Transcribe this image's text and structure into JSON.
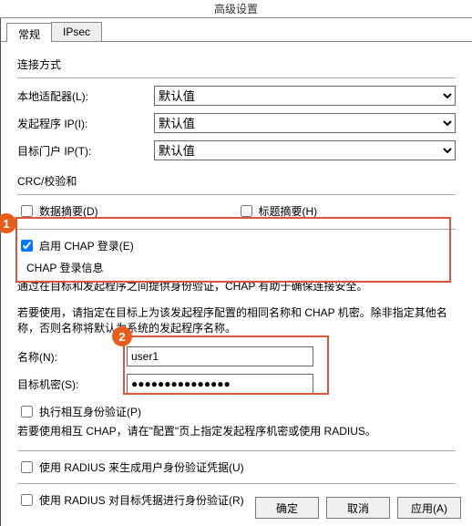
{
  "window": {
    "title": "高级设置"
  },
  "tabs": {
    "general": "常规",
    "ipsec": "IPsec"
  },
  "connection": {
    "group_label": "连接方式",
    "local_adapter_label": "本地适配器(L):",
    "local_adapter_value": "默认值",
    "initiator_ip_label": "发起程序 IP(I):",
    "initiator_ip_value": "默认值",
    "target_portal_ip_label": "目标门户 IP(T):",
    "target_portal_ip_value": "默认值"
  },
  "crc": {
    "group_label": "CRC/校验和",
    "data_digest_label": "数据摘要(D)",
    "header_digest_label": "标题摘要(H)"
  },
  "chap": {
    "enable_label": "启用 CHAP 登录(E)",
    "info_title": "CHAP 登录信息",
    "info_desc": "通过在目标和发起程序之间提供身份验证，CHAP 有助于确保连接安全。",
    "usage_note": "若要使用，请指定在目标上为该发起程序配置的相同名称和 CHAP 机密。除非指定其他名称，否则名称将默认为系统的发起程序名称。",
    "name_label": "名称(N):",
    "name_value": "user1",
    "secret_label": "目标机密(S):",
    "secret_value": "●●●●●●●●●●●●●●●",
    "mutual_label": "执行相互身份验证(P)",
    "mutual_note": "若要使用相互 CHAP，请在\"配置\"页上指定发起程序机密或使用 RADIUS。",
    "radius_cred_label": "使用 RADIUS 来生成用户身份验证凭据(U)",
    "radius_auth_label": "使用 RADIUS 对目标凭据进行身份验证(R)"
  },
  "buttons": {
    "ok": "确定",
    "cancel": "取消",
    "apply": "应用(A)"
  },
  "badges": {
    "one": "1",
    "two": "2"
  }
}
